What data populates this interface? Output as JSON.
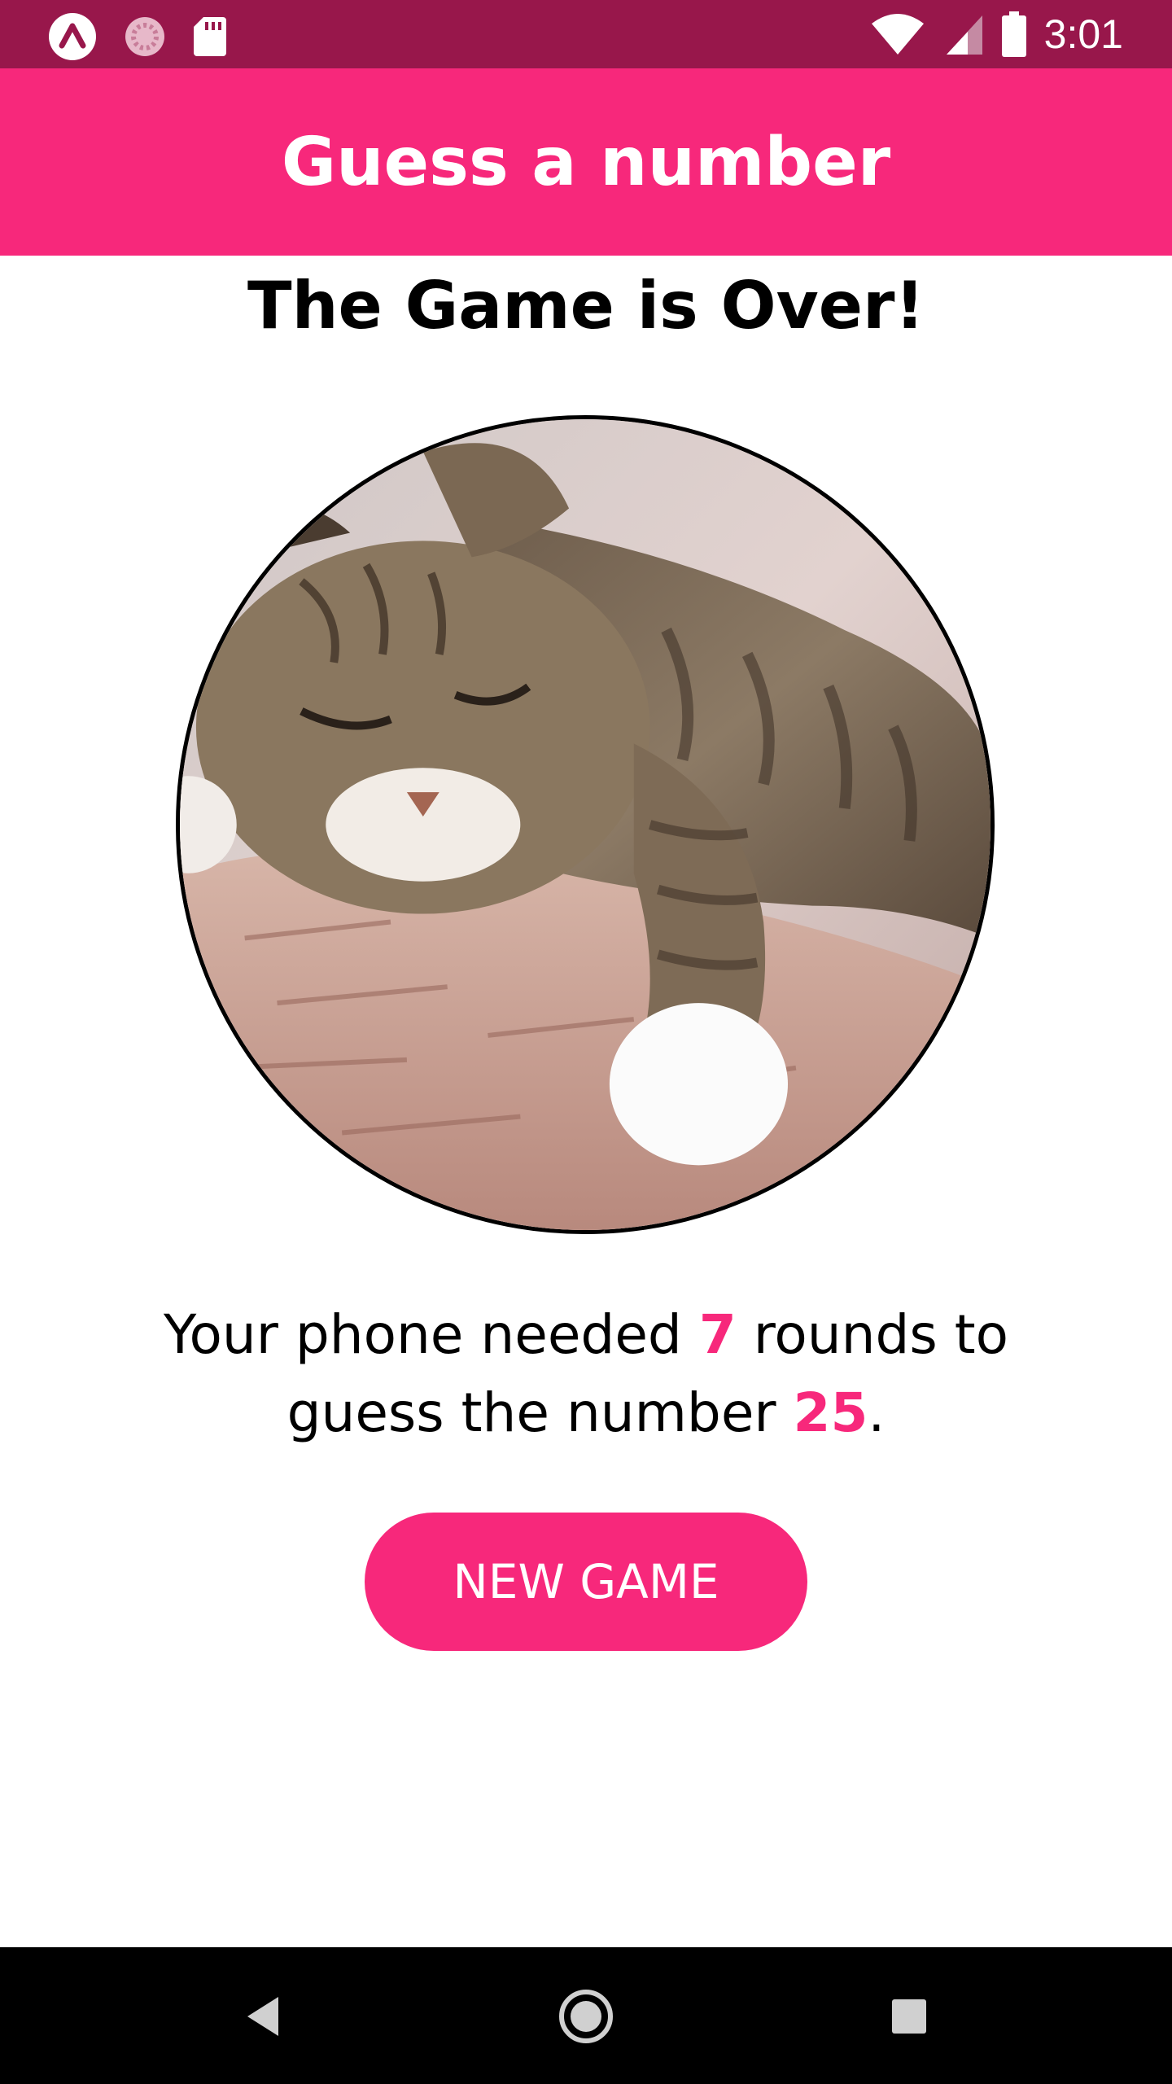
{
  "status_bar": {
    "time": "3:01",
    "icons_left": [
      "expo-icon",
      "loading-icon",
      "sd-card-icon"
    ],
    "icons_right": [
      "wifi-icon",
      "signal-icon",
      "battery-icon"
    ]
  },
  "header": {
    "title": "Guess a number"
  },
  "main": {
    "title": "The Game is Over!",
    "image": "sleeping-cat-image",
    "result_prefix": "Your phone needed ",
    "rounds": "7",
    "result_middle": " rounds to guess the number ",
    "number": "25",
    "result_suffix": ".",
    "new_game_label": "NEW GAME"
  },
  "nav_bar": {
    "buttons": [
      "back-icon",
      "home-icon",
      "recents-icon"
    ]
  },
  "colors": {
    "primary": "#f7287b",
    "status_bar": "#98174b",
    "nav_bar": "#000000"
  }
}
